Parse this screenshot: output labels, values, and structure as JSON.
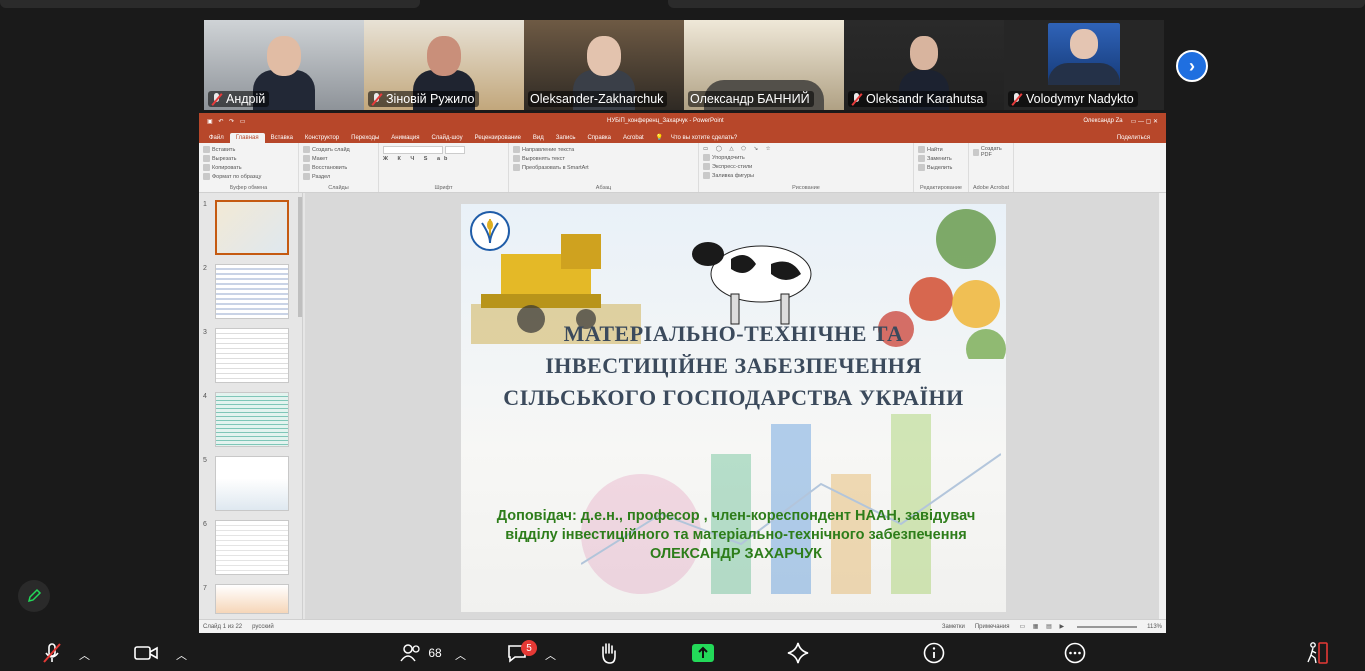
{
  "participants": [
    {
      "name": "Андрій",
      "muted": true
    },
    {
      "name": "Зіновій Ружило",
      "muted": true
    },
    {
      "name": "Oleksander-Zakharchuk",
      "muted": false,
      "speaking": true
    },
    {
      "name": "Олександр БАННИЙ",
      "muted": true
    },
    {
      "name": "Oleksandr Karahutsa",
      "muted": true
    },
    {
      "name": "Volodymyr Nadykto",
      "muted": true
    }
  ],
  "powerpoint": {
    "window_title": "НУБіП_конференц_Захарчук  -  PowerPoint",
    "user": "Олександр Za",
    "search_hint": "Что вы хотите сделать?",
    "share_label": "Поделиться",
    "tabs": [
      "Файл",
      "Главная",
      "Вставка",
      "Конструктор",
      "Переходы",
      "Анимация",
      "Слайд-шоу",
      "Рецензирование",
      "Вид",
      "Запись",
      "Справка",
      "Acrobat"
    ],
    "selected_tab": "Главная",
    "ribbon_groups": [
      {
        "label": "Буфер обмена",
        "items": [
          "Вставить",
          "Вырезать",
          "Копировать",
          "Формат по образцу"
        ]
      },
      {
        "label": "Слайды",
        "items": [
          "Создать слайд",
          "Макет",
          "Восстановить",
          "Раздел"
        ]
      },
      {
        "label": "Шрифт",
        "items": []
      },
      {
        "label": "Абзац",
        "items": [
          "Направление текста",
          "Выровнять текст",
          "Преобразовать в SmartArt"
        ]
      },
      {
        "label": "Рисование",
        "items": [
          "Упорядочить",
          "Экспресс-стили",
          "Заливка фигуры",
          "Контур фигуры",
          "Эффекты фигуры"
        ]
      },
      {
        "label": "Редактирование",
        "items": [
          "Найти",
          "Заменить",
          "Выделить"
        ]
      },
      {
        "label": "Adobe Acrobat",
        "items": [
          "Создать PDF"
        ]
      }
    ],
    "slide_numbers": [
      "1",
      "2",
      "3",
      "4",
      "5",
      "6",
      "7"
    ],
    "status": {
      "slide_of": "Слайд 1 из 22",
      "language": "русский",
      "notes": "Заметки",
      "comments": "Примечания",
      "zoom": "113%"
    }
  },
  "slide": {
    "title_lines": [
      "МАТЕРІАЛЬНО-ТЕХНІЧНЕ ТА",
      "ІНВЕСТИЦІЙНЕ ЗАБЕЗПЕЧЕННЯ",
      "СІЛЬСЬКОГО ГОСПОДАРСТВА УКРАЇНИ"
    ],
    "speaker_lines": [
      "Доповідач:   д.е.н., професор , член-кореспондент НААН, завідувач",
      "відділу інвестиційного та матеріально-технічного забезпечення",
      "ОЛЕКСАНДР  ЗАХАРЧУК"
    ]
  },
  "toolbar": {
    "participants_count": "68",
    "chat_badge": "5"
  },
  "colors": {
    "accent_green": "#23d959",
    "ppt_red": "#b7472a",
    "title": "#3b4a5c",
    "speaker": "#2d7d1a"
  }
}
